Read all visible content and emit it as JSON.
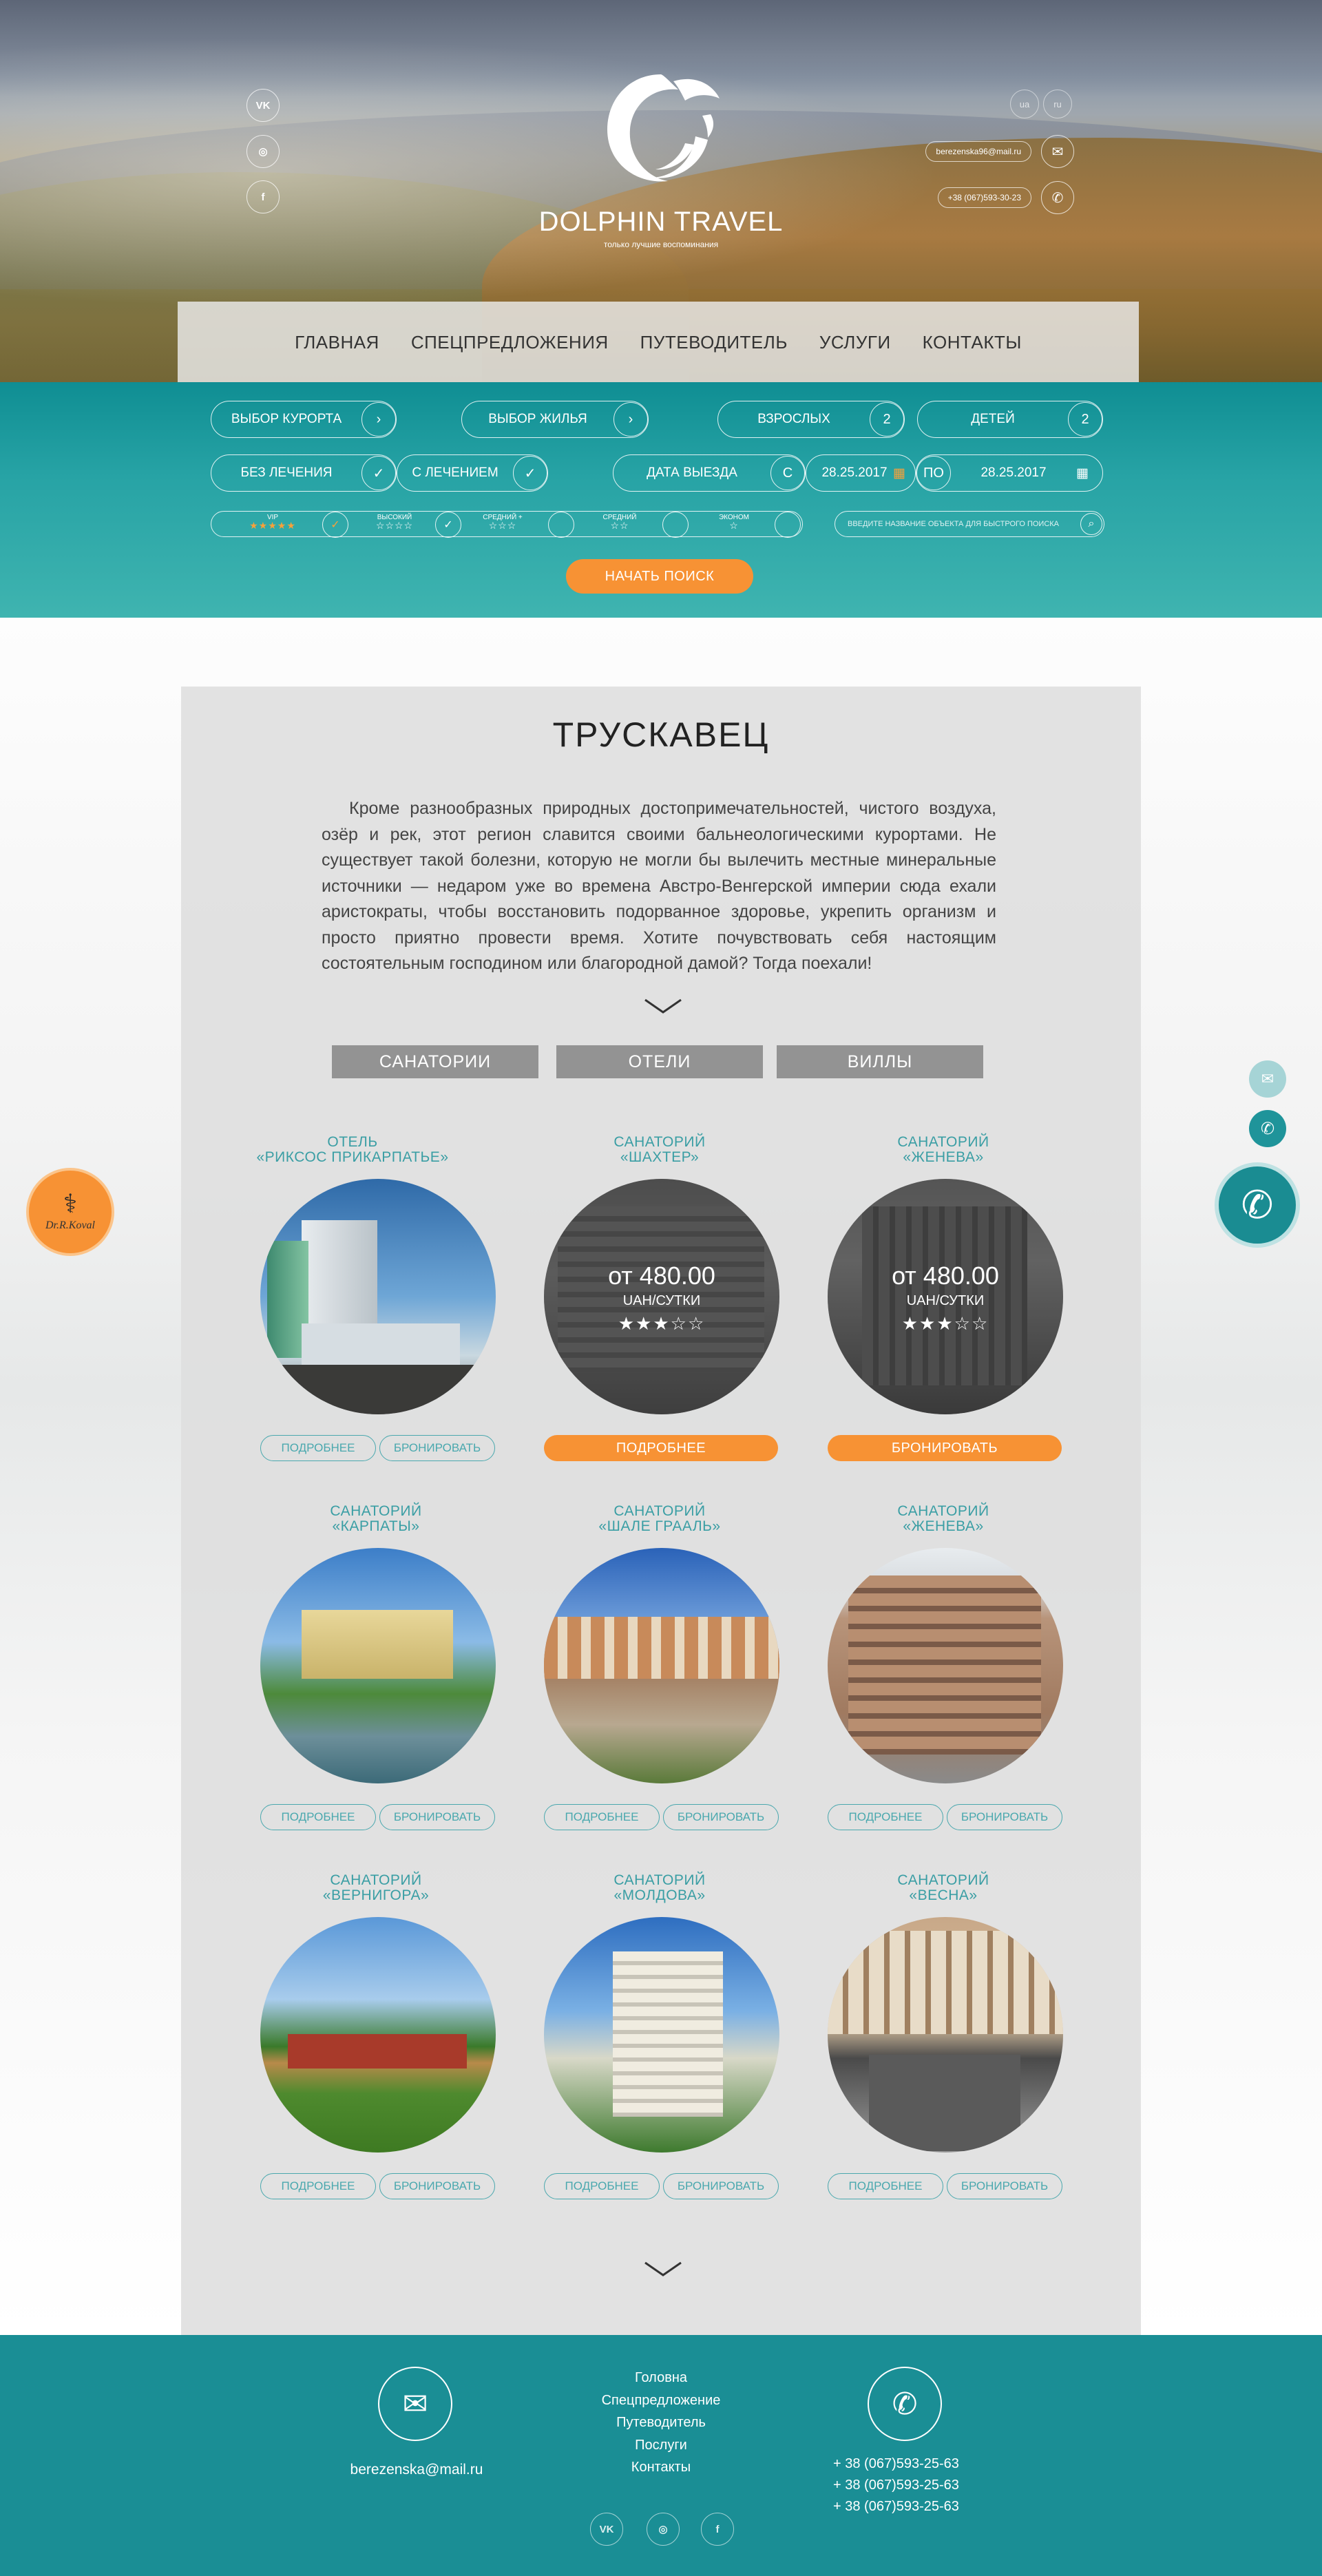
{
  "header": {
    "brand": "DOLPHIN TRAVEL",
    "tagline": "только лучшие воспоминания",
    "social": [
      "vk",
      "instagram",
      "facebook"
    ],
    "social_glyphs": {
      "vk": "VK",
      "instagram": "◎",
      "facebook": "f"
    },
    "languages": [
      "ua",
      "ru"
    ],
    "email": "berezenska96@mail.ru",
    "phone": "+38 (067)593-30-23"
  },
  "nav": [
    "ГЛАВНАЯ",
    "СПЕЦПРЕДЛОЖЕНИЯ",
    "ПУТЕВОДИТЕЛЬ",
    "УСЛУГИ",
    "КОНТАКТЫ"
  ],
  "search": {
    "resort_label": "ВЫБОР КУРОРТА",
    "housing_label": "ВЫБОР ЖИЛЬЯ",
    "adults_label": "ВЗРОСЛЫХ",
    "adults_value": "2",
    "children_label": "ДЕТЕЙ",
    "children_value": "2",
    "no_treatment_label": "БЕЗ ЛЕЧЕНИЯ",
    "with_treatment_label": "С ЛЕЧЕНИЕМ",
    "departure_label": "ДАТА ВЫЕЗДА",
    "from_label": "С",
    "from_date": "28.25.2017",
    "to_label": "ПО",
    "to_date": "28.25.2017",
    "star_classes": [
      {
        "label": "VIP",
        "stars": "★★★★★",
        "checked": true
      },
      {
        "label": "ВЫСОКИЙ",
        "stars": "☆☆☆☆",
        "checked": false
      },
      {
        "label": "СРЕДНИЙ +",
        "stars": "☆☆☆",
        "checked": false
      },
      {
        "label": "СРЕДНИЙ",
        "stars": "☆☆",
        "checked": false
      },
      {
        "label": "ЭКОНОМ",
        "stars": "☆",
        "checked": false
      }
    ],
    "quick_placeholder": "ВВЕДИТЕ НАЗВАНИЕ ОБЪЕКТА ДЛЯ БЫСТРОГО ПОИСКА",
    "submit_label": "НАЧАТЬ ПОИСК"
  },
  "city": {
    "title": "ТРУСКАВЕЦ",
    "description": "Кроме разнообразных природных достопримечательностей, чистого воздуха, озёр и рек, этот регион славится своими бальнеологическими курортами. Не существует такой болезни, которую не могли бы вылечить местные минеральные источники — недаром уже во времена Австро-Венгерской империи сюда ехали аристократы, чтобы восстановить подорванное здоровье, укрепить организм и просто приятно провести время. Хотите почувствовать себя настоящим состоятельным господином или благородной дамой? Тогда поехали!"
  },
  "tabs": [
    "САНАТОРИИ",
    "ОТЕЛИ",
    "ВИЛЛЫ"
  ],
  "buttons": {
    "details": "ПОДРОБНЕЕ",
    "book": "БРОНИРОВАТЬ"
  },
  "hotels": [
    {
      "type": "ОТЕЛЬ",
      "name": "«РИКСОС ПРИКАРПАТЬЕ»",
      "hover": false
    },
    {
      "type": "САНАТОРИЙ",
      "name": "«ШАХТЕР»",
      "hover": true,
      "price": "от 480.00",
      "unit": "UAH/СУТКИ",
      "rating": "★★★☆☆"
    },
    {
      "type": "САНАТОРИЙ",
      "name": "«ЖЕНЕВА»",
      "hover": true,
      "price": "от 480.00",
      "unit": "UAH/СУТКИ",
      "rating": "★★★☆☆"
    },
    {
      "type": "САНАТОРИЙ",
      "name": "«КАРПАТЫ»",
      "hover": false
    },
    {
      "type": "САНАТОРИЙ",
      "name": "«ШАЛЕ ГРААЛЬ»",
      "hover": false
    },
    {
      "type": "САНАТОРИЙ",
      "name": "«ЖЕНЕВА»",
      "hover": false
    },
    {
      "type": "САНАТОРИЙ",
      "name": "«ВЕРНИГОРА»",
      "hover": false
    },
    {
      "type": "САНАТОРИЙ",
      "name": "«МОЛДОВА»",
      "hover": false
    },
    {
      "type": "САНАТОРИЙ",
      "name": "«ВЕСНА»",
      "hover": false
    }
  ],
  "partner": {
    "name": "Dr.R.Koval"
  },
  "footer": {
    "email": "berezenska@mail.ru",
    "menu": [
      "Головна",
      "Спецпредложение",
      "Путеводитель",
      "Послуги",
      "Контакты"
    ],
    "phones": [
      "+ 38 (067)593-25-63",
      "+ 38 (067)593-25-63",
      "+ 38 (067)593-25-63"
    ]
  },
  "colors": {
    "accent": "#1a8e95",
    "orange": "#f79234",
    "teal_text": "#3a9ea4"
  }
}
